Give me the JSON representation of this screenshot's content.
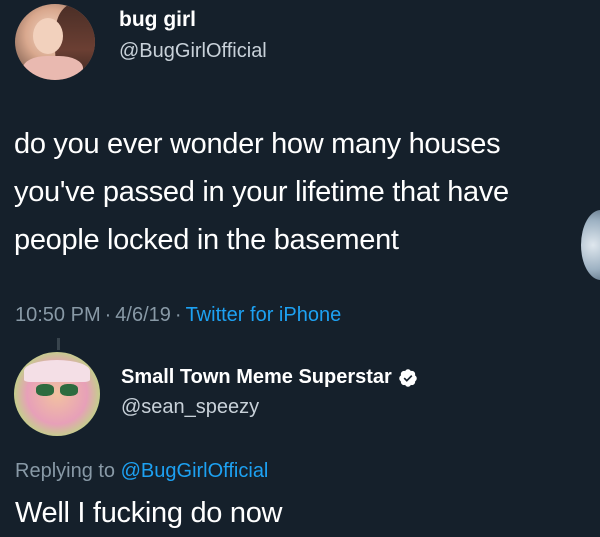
{
  "tweet": {
    "author": {
      "display_name": "bug girl",
      "handle": "@BugGirlOfficial"
    },
    "text_lines": [
      "do you ever wonder how many houses",
      "you've passed in your lifetime that have",
      "people locked in the basement"
    ],
    "meta": {
      "time": "10:50 PM",
      "separator": "·",
      "date": "4/6/19",
      "source": "Twitter for iPhone"
    }
  },
  "reply": {
    "author": {
      "display_name": "Small Town Meme Superstar",
      "handle": "@sean_speezy",
      "verified": true
    },
    "replying_to_label": "Replying to",
    "replying_to_handle": "@BugGirlOfficial",
    "text": "Well I fucking do now"
  },
  "colors": {
    "background": "#15202b",
    "text": "#ffffff",
    "secondary_text": "#8899a6",
    "accent": "#1da1f2"
  }
}
